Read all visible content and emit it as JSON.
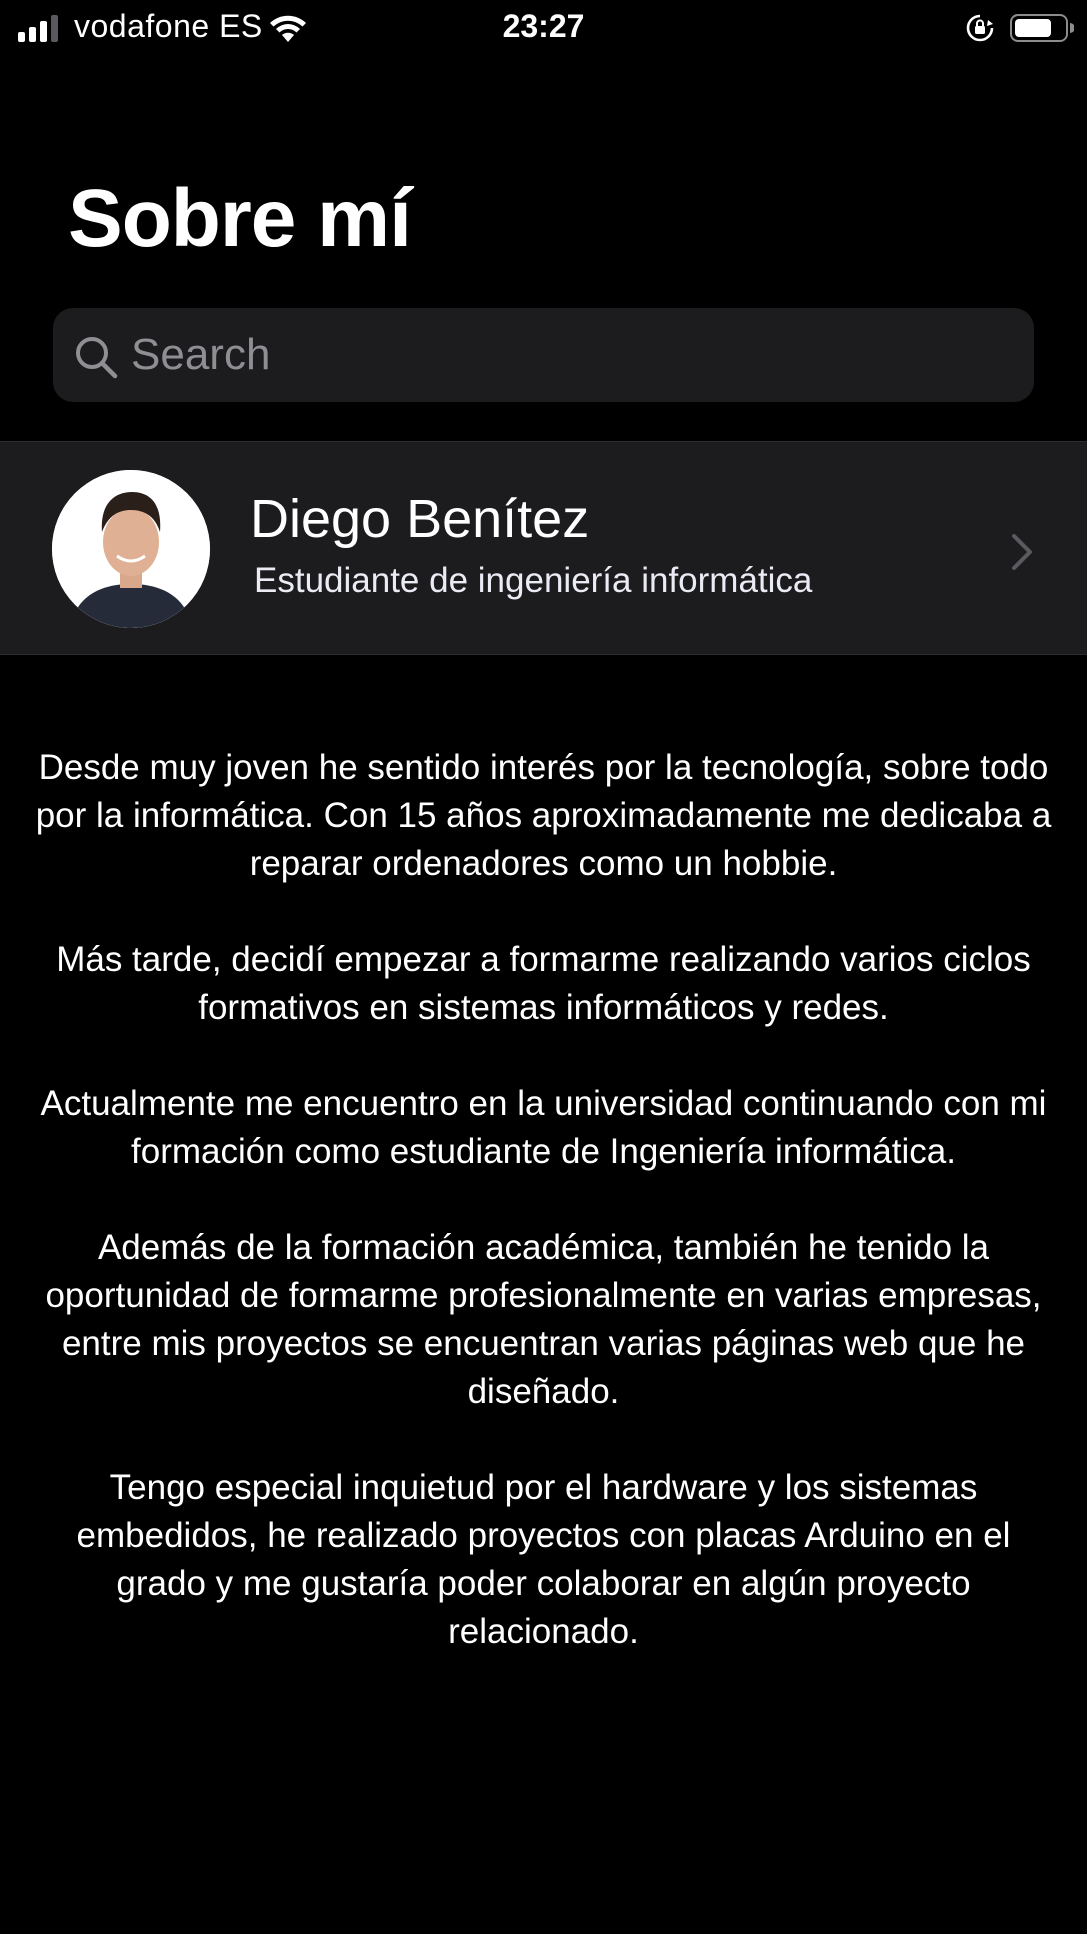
{
  "status_bar": {
    "carrier": "vodafone ES",
    "time": "23:27",
    "signal_bars": 3,
    "battery_level": 0.75
  },
  "header": {
    "title": "Sobre mí"
  },
  "search": {
    "placeholder": "Search",
    "value": ""
  },
  "profile": {
    "name": "Diego Benítez",
    "subtitle": "Estudiante de ingeniería informática"
  },
  "bio": {
    "paragraphs": [
      "Desde muy joven he sentido interés por la tecnología, sobre todo por la informática. Con 15 años aproximadamente me dedicaba a reparar ordenadores como un hobbie.",
      "Más tarde, decidí empezar a formarme realizando varios ciclos formativos en sistemas informáticos y redes.",
      "Actualmente me encuentro en la universidad continuando con mi formación como estudiante de Ingeniería informática.",
      "Además de la formación académica, también he tenido la oportunidad de formarme profesionalmente en varias empresas, entre mis proyectos se encuentran varias páginas web que he diseñado.",
      "Tengo especial inquietud por el hardware y los sistemas embedidos, he realizado proyectos con placas Arduino en el grado y me gustaría  poder colaborar en algún proyecto relacionado."
    ]
  },
  "colors": {
    "background": "#000000",
    "cell_background": "#1c1c1e",
    "text": "#ffffff",
    "placeholder": "#8e8e93",
    "chevron": "#5a5a5e"
  },
  "icons": [
    "signal-icon",
    "wifi-icon",
    "rotation-lock-icon",
    "battery-icon",
    "search-icon",
    "chevron-right-icon"
  ]
}
